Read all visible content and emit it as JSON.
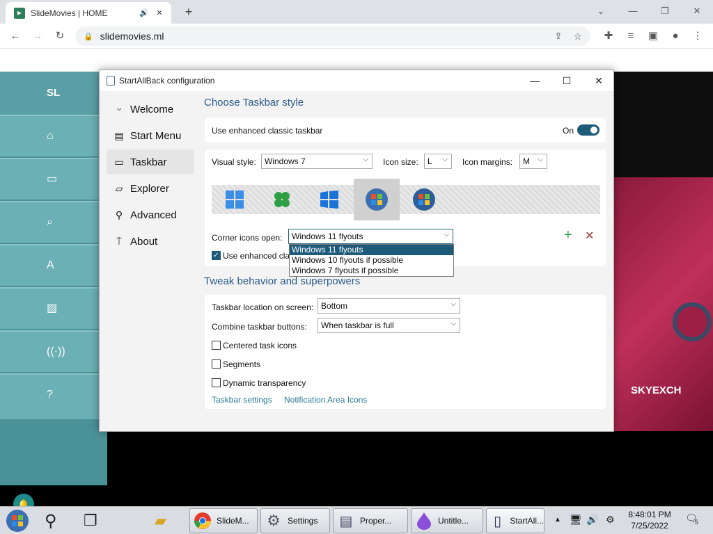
{
  "browser": {
    "tab_title": "SlideMovies | HOME",
    "url": "slidemovies.ml"
  },
  "site": {
    "logo": "SL",
    "nav": [
      "home-icon",
      "monitor-icon",
      "search-icon",
      "A",
      "photo-icon",
      "broadcast-icon",
      "?"
    ],
    "video_brand": "SKYEXCH"
  },
  "dialog": {
    "title": "StartAllBack configuration",
    "nav": [
      {
        "label": "Welcome",
        "icon": "smile-icon"
      },
      {
        "label": "Start Menu",
        "icon": "start-menu-icon"
      },
      {
        "label": "Taskbar",
        "icon": "taskbar-icon"
      },
      {
        "label": "Explorer",
        "icon": "folder-icon"
      },
      {
        "label": "Advanced",
        "icon": "wrench-icon"
      },
      {
        "label": "About",
        "icon": "about-icon"
      }
    ],
    "section1_title": "Choose Taskbar style",
    "enhanced_label": "Use enhanced classic taskbar",
    "toggle_state": "On",
    "visual_style_label": "Visual style:",
    "visual_style_value": "Windows 7",
    "icon_size_label": "Icon size:",
    "icon_size_value": "L",
    "icon_margins_label": "Icon margins:",
    "icon_margins_value": "M",
    "corner_label": "Corner icons open:",
    "corner_value": "Windows 11 flyouts",
    "corner_options": [
      "Windows 11 flyouts",
      "Windows 10 flyouts if possible",
      "Windows 7 flyouts if possible"
    ],
    "enhanced_class_label": "Use enhanced clas",
    "section2_title": "Tweak behavior and superpowers",
    "location_label": "Taskbar location on screen:",
    "location_value": "Bottom",
    "combine_label": "Combine taskbar buttons:",
    "combine_value": "When taskbar is full",
    "centered_label": "Centered task icons",
    "segments_label": "Segments",
    "transparency_label": "Dynamic transparency",
    "link_taskbar": "Taskbar settings",
    "link_notif": "Notification Area Icons"
  },
  "taskbar": {
    "buttons": [
      "SlideM...",
      "Settings",
      "Proper...",
      "Untitle...",
      "StartAll..."
    ],
    "time": "8:48:01 PM",
    "date": "7/25/2022",
    "notif_count": "5"
  }
}
